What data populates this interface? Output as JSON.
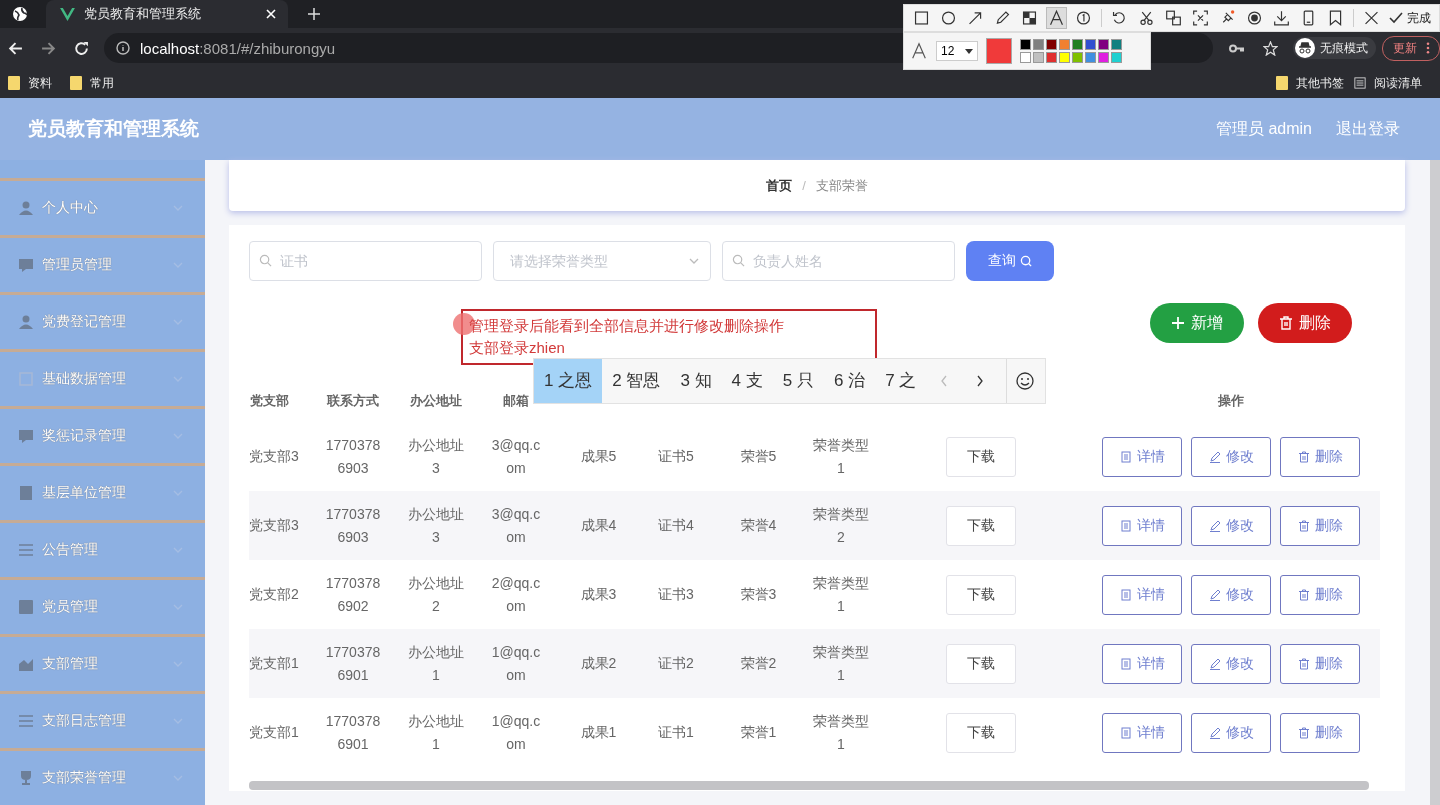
{
  "browser": {
    "tab_title": "党员教育和管理系统",
    "url_host": "localhost",
    "url_rest": ":8081/#/zhiburongyu",
    "bookmarks": [
      "资料",
      "常用"
    ],
    "right_bookmarks": [
      {
        "label": "其他书签",
        "kind": "folder"
      },
      {
        "label": "阅读清单",
        "kind": "list"
      }
    ],
    "incognito": "无痕模式",
    "update": "更新"
  },
  "capture_toolbar": {
    "tools": [
      {
        "kind": "rect",
        "selected": false
      },
      {
        "kind": "circle",
        "selected": false
      },
      {
        "kind": "arrow",
        "selected": false
      },
      {
        "kind": "pen",
        "selected": false
      },
      {
        "kind": "mosaic",
        "selected": false
      },
      {
        "kind": "text",
        "selected": true
      },
      {
        "kind": "number",
        "selected": false
      },
      {
        "kind": "undo",
        "selected": false
      },
      {
        "kind": "cut",
        "selected": false
      },
      {
        "kind": "translate",
        "selected": false
      },
      {
        "kind": "ocr",
        "selected": false
      },
      {
        "kind": "pin",
        "selected": false
      },
      {
        "kind": "record",
        "selected": false
      },
      {
        "kind": "download",
        "selected": false
      },
      {
        "kind": "phone",
        "selected": false
      },
      {
        "kind": "bookmark",
        "selected": false
      },
      {
        "kind": "close",
        "selected": false
      }
    ],
    "done": "完成",
    "font_size": "12",
    "palette": [
      {
        "color": "#000000"
      },
      {
        "color": "#808080"
      },
      {
        "color": "#800000"
      },
      {
        "color": "#f08030"
      },
      {
        "color": "#208020"
      },
      {
        "color": "#3050d0"
      },
      {
        "color": "#800080"
      },
      {
        "color": "#108080"
      },
      {
        "color": "#ffffff"
      },
      {
        "color": "#c0c0c0"
      },
      {
        "color": "#e03030"
      },
      {
        "color": "#ffff00"
      },
      {
        "color": "#80c000"
      },
      {
        "color": "#4090e0"
      },
      {
        "color": "#e020e0"
      },
      {
        "color": "#20d0d0"
      }
    ]
  },
  "app": {
    "title": "党员教育和管理系统",
    "user": "管理员 admin",
    "logout": "退出登录"
  },
  "sidebar": {
    "items": [
      {
        "label": "个人中心",
        "kind": "person"
      },
      {
        "label": "管理员管理",
        "kind": "chat"
      },
      {
        "label": "党费登记管理",
        "kind": "person"
      },
      {
        "label": "基础数据管理",
        "kind": "grid"
      },
      {
        "label": "奖惩记录管理",
        "kind": "chat"
      },
      {
        "label": "基层单位管理",
        "kind": "building"
      },
      {
        "label": "公告管理",
        "kind": "list"
      },
      {
        "label": "党员管理",
        "kind": "card"
      },
      {
        "label": "支部管理",
        "kind": "chart"
      },
      {
        "label": "支部日志管理",
        "kind": "list"
      },
      {
        "label": "支部荣誉管理",
        "kind": "trophy"
      }
    ]
  },
  "breadcrumb": {
    "items": [
      "首页",
      "支部荣誉"
    ],
    "separator": "/"
  },
  "search": {
    "certificate_placeholder": "证书",
    "type_placeholder": "请选择荣誉类型",
    "leader_placeholder": "负责人姓名",
    "query_button": "查询"
  },
  "actions": {
    "add": "新增",
    "delete": "删除"
  },
  "annotation": {
    "lines": [
      "管理登录后能看到全部信息并进行修改删除操作",
      "支部登录zhien"
    ]
  },
  "ime": {
    "candidates": [
      {
        "index": "1",
        "text": "之恩",
        "selected": true
      },
      {
        "index": "2",
        "text": "智恩",
        "selected": false
      },
      {
        "index": "3",
        "text": "知",
        "selected": false
      },
      {
        "index": "4",
        "text": "支",
        "selected": false
      },
      {
        "index": "5",
        "text": "只",
        "selected": false
      },
      {
        "index": "6",
        "text": "治",
        "selected": false
      },
      {
        "index": "7",
        "text": "之",
        "selected": false
      }
    ]
  },
  "table": {
    "columns": [
      "党支部",
      "联系方式",
      "办公地址",
      "邮箱"
    ],
    "actions_column": "操作",
    "rows": [
      {
        "cells": [
          "党支部3",
          "17703786903",
          "办公地址3",
          "3@qq.com",
          "成果5",
          "证书5",
          "荣誉5",
          "荣誉类型1"
        ],
        "download": "下载",
        "actions": [
          {
            "label": "详情",
            "kind": "detail"
          },
          {
            "label": "修改",
            "kind": "edit"
          },
          {
            "label": "删除",
            "kind": "delete"
          }
        ]
      },
      {
        "cells": [
          "党支部3",
          "17703786903",
          "办公地址3",
          "3@qq.com",
          "成果4",
          "证书4",
          "荣誉4",
          "荣誉类型2"
        ],
        "download": "下载",
        "actions": [
          {
            "label": "详情",
            "kind": "detail"
          },
          {
            "label": "修改",
            "kind": "edit"
          },
          {
            "label": "删除",
            "kind": "delete"
          }
        ]
      },
      {
        "cells": [
          "党支部2",
          "17703786902",
          "办公地址2",
          "2@qq.com",
          "成果3",
          "证书3",
          "荣誉3",
          "荣誉类型1"
        ],
        "download": "下载",
        "actions": [
          {
            "label": "详情",
            "kind": "detail"
          },
          {
            "label": "修改",
            "kind": "edit"
          },
          {
            "label": "删除",
            "kind": "delete"
          }
        ]
      },
      {
        "cells": [
          "党支部1",
          "17703786901",
          "办公地址1",
          "1@qq.com",
          "成果2",
          "证书2",
          "荣誉2",
          "荣誉类型1"
        ],
        "download": "下载",
        "actions": [
          {
            "label": "详情",
            "kind": "detail"
          },
          {
            "label": "修改",
            "kind": "edit"
          },
          {
            "label": "删除",
            "kind": "delete"
          }
        ]
      },
      {
        "cells": [
          "党支部1",
          "17703786901",
          "办公地址1",
          "1@qq.com",
          "成果1",
          "证书1",
          "荣誉1",
          "荣誉类型1"
        ],
        "download": "下载",
        "actions": [
          {
            "label": "详情",
            "kind": "detail"
          },
          {
            "label": "修改",
            "kind": "edit"
          },
          {
            "label": "删除",
            "kind": "delete"
          }
        ]
      }
    ]
  }
}
